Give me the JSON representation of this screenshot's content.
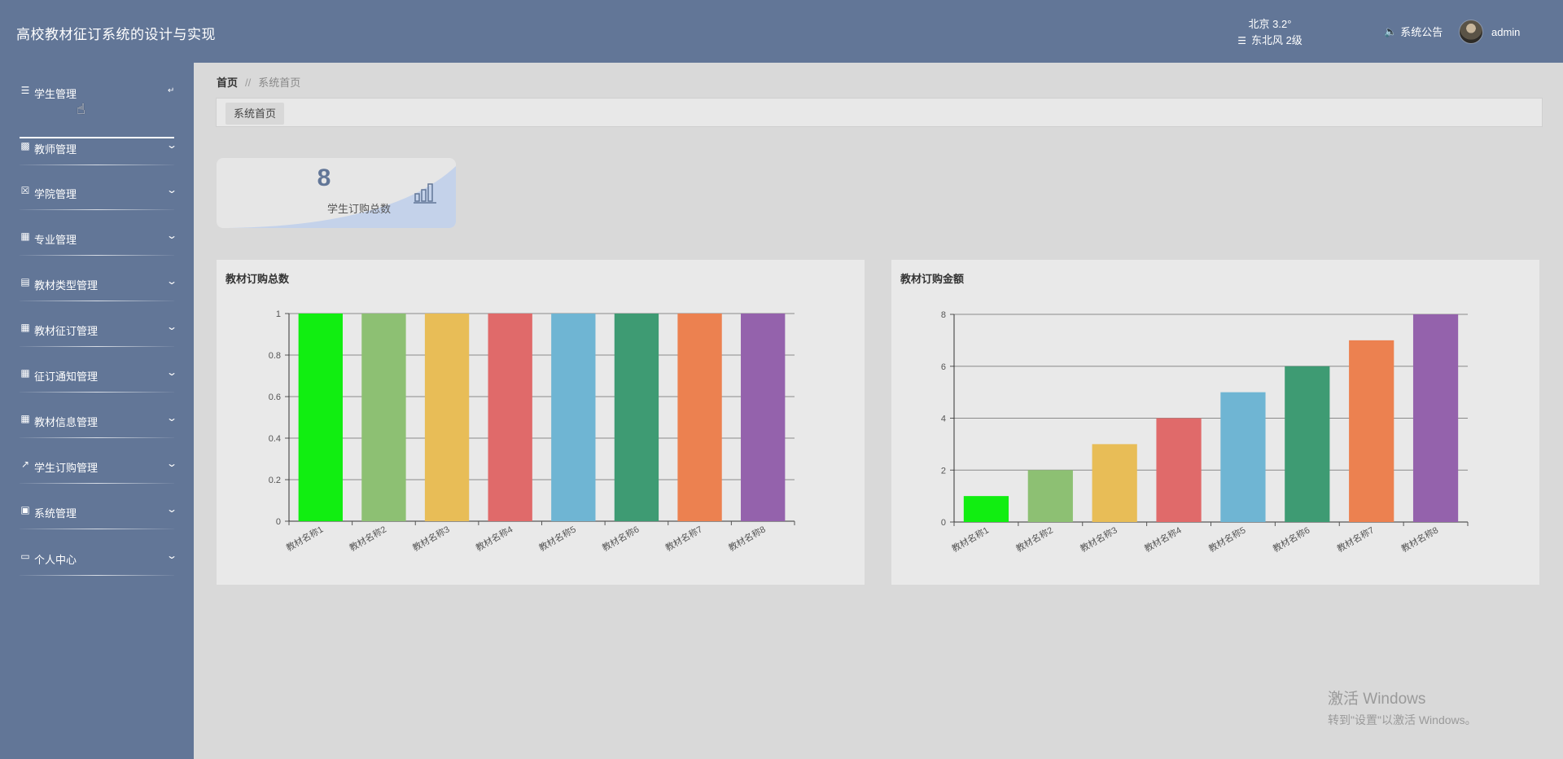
{
  "header": {
    "title": "高校教材征订系统的设计与实现",
    "weather": {
      "city_temp": "北京  3.2°",
      "wind": "东北风  2级"
    },
    "notice_label": "系统公告",
    "username": "admin"
  },
  "sidebar": {
    "items": [
      {
        "icon": "list-icon",
        "label": "学生管理"
      },
      {
        "icon": "clipboard-icon",
        "label": "教师管理"
      },
      {
        "icon": "clipboard-x-icon",
        "label": "学院管理"
      },
      {
        "icon": "grid-icon",
        "label": "专业管理"
      },
      {
        "icon": "book-icon",
        "label": "教材类型管理"
      },
      {
        "icon": "grid-icon",
        "label": "教材征订管理"
      },
      {
        "icon": "grid-icon",
        "label": "征订通知管理"
      },
      {
        "icon": "grid-icon",
        "label": "教材信息管理"
      },
      {
        "icon": "chart-line-icon",
        "label": "学生订购管理"
      },
      {
        "icon": "folder-icon",
        "label": "系统管理"
      },
      {
        "icon": "card-icon",
        "label": "个人中心"
      }
    ]
  },
  "breadcrumb": {
    "home": "首页",
    "sep": "//",
    "current": "系统首页"
  },
  "tabs": [
    {
      "label": "系统首页"
    }
  ],
  "stat": {
    "value": "8",
    "label": "学生订购总数"
  },
  "panels": {
    "left_title": "教材订购总数",
    "right_title": "教材订购金额"
  },
  "watermark": {
    "line1": "激活 Windows",
    "line2": "转到\"设置\"以激活 Windows。"
  },
  "colors": {
    "header_bg": "#627697",
    "bars": [
      "#11ee11",
      "#8dc073",
      "#e8bd57",
      "#e06a6a",
      "#6fb5d3",
      "#3e9b73",
      "#ec8150",
      "#9462ac"
    ]
  },
  "chart_data": [
    {
      "type": "bar",
      "title": "教材订购总数",
      "categories": [
        "教材名称1",
        "教材名称2",
        "教材名称3",
        "教材名称4",
        "教材名称5",
        "教材名称6",
        "教材名称7",
        "教材名称8"
      ],
      "values": [
        1,
        1,
        1,
        1,
        1,
        1,
        1,
        1
      ],
      "ylim": [
        0,
        1
      ],
      "yticks": [
        "0",
        "0.2",
        "0.4",
        "0.6",
        "0.8",
        "1"
      ],
      "grid": true
    },
    {
      "type": "bar",
      "title": "教材订购金额",
      "categories": [
        "教材名称1",
        "教材名称2",
        "教材名称3",
        "教材名称4",
        "教材名称5",
        "教材名称6",
        "教材名称7",
        "教材名称8"
      ],
      "values": [
        1,
        2,
        3,
        4,
        5,
        6,
        7,
        8
      ],
      "ylim": [
        0,
        8
      ],
      "yticks": [
        "0",
        "2",
        "4",
        "6",
        "8"
      ],
      "grid": true
    }
  ]
}
